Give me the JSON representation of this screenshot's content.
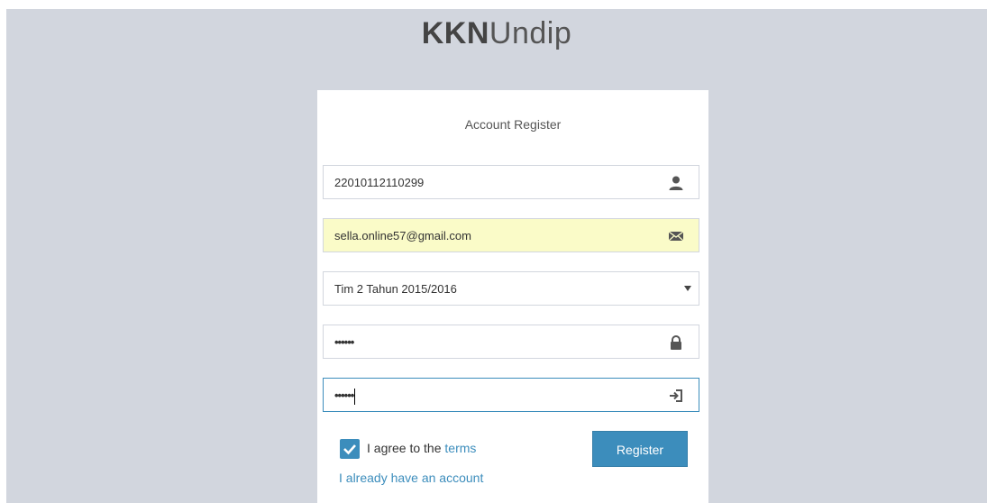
{
  "brand": {
    "bold": "KKN",
    "light": "Undip"
  },
  "register": {
    "title": "Account Register",
    "nim_value": "22010112110299",
    "email_value": "sella.online57@gmail.com",
    "team_selected": "Tim 2 Tahun 2015/2016",
    "password_value": "••••••",
    "confirm_value": "••••••",
    "agree_prefix": "I agree to the ",
    "terms_link": "terms",
    "register_button": "Register",
    "have_account_link": "I already have an account",
    "agree_checked": true
  },
  "icons": {
    "nim": "user-icon",
    "email": "envelope-icon",
    "team": "chevron-down-icon",
    "password": "lock-icon",
    "confirm": "log-in-icon",
    "checkbox": "check-icon"
  },
  "colors": {
    "background": "#d2d6de",
    "primary": "#3c8dbc",
    "autofill": "#fafbc8"
  }
}
